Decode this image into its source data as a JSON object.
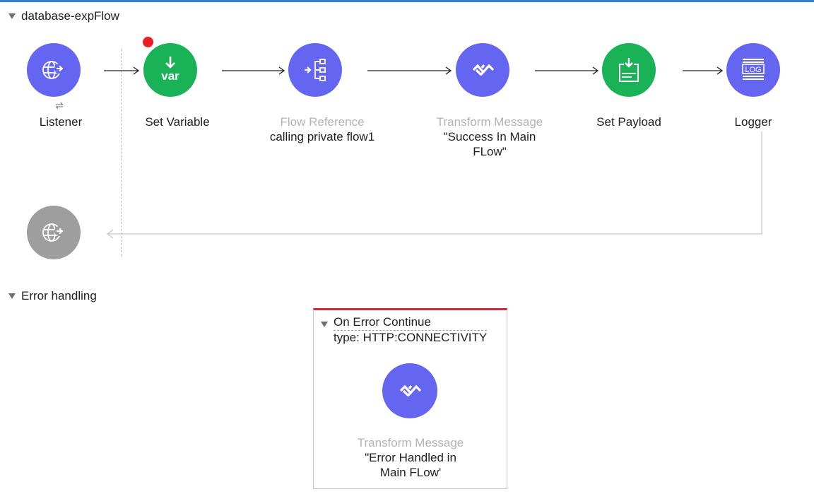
{
  "flow": {
    "name": "database-expFlow",
    "nodes": [
      {
        "id": "listener",
        "label": "Listener",
        "color": "#6466f1",
        "icon": "globe-arrow-icon"
      },
      {
        "id": "set-variable",
        "label": "Set Variable",
        "color": "#19b257",
        "icon": "var-icon",
        "icon_text": "var"
      },
      {
        "id": "flow-reference",
        "type_label": "Flow Reference",
        "label": "calling private flow1",
        "color": "#6466f1",
        "icon": "flow-reference-icon"
      },
      {
        "id": "transform-message",
        "type_label": "Transform Message",
        "label": "\"Success In Main FLow\"",
        "color": "#6466f1",
        "icon": "dataweave-icon"
      },
      {
        "id": "set-payload",
        "label": "Set Payload",
        "color": "#19b257",
        "icon": "set-payload-icon"
      },
      {
        "id": "logger",
        "label": "Logger",
        "color": "#6466f1",
        "icon": "log-icon",
        "icon_text": "LOG"
      }
    ],
    "response_node": {
      "icon": "globe-arrow-icon",
      "color": "#9e9e9e"
    }
  },
  "error_handling": {
    "label": "Error handling",
    "handler": {
      "title": "On Error Continue",
      "type": "type: HTTP:CONNECTIVITY",
      "component": {
        "type_label": "Transform Message",
        "label": "\"Error Handled in Main FLow'",
        "icon": "dataweave-icon",
        "color": "#6466f1"
      }
    }
  }
}
